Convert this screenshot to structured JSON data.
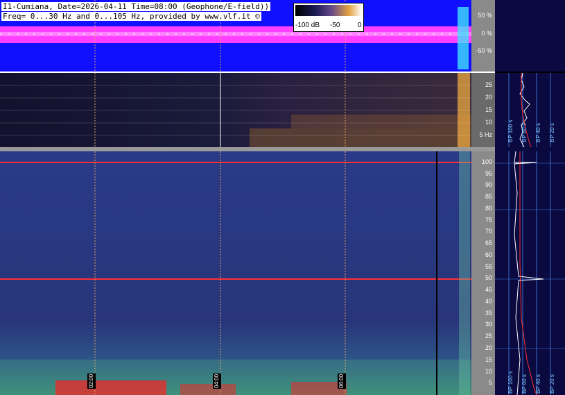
{
  "header": {
    "line1": "I1-Cumiana, Date=2026-04-11 Time=08:00 (Geophone/E-field))",
    "line2": "Freq= 0...30 Hz and 0...105 Hz, provided by www.vlf.it ©"
  },
  "legend": {
    "min_label": "-100 dB",
    "mid_label": "-50",
    "max_label": "0"
  },
  "waveform_axis": {
    "ticks": [
      "50 %",
      "0 %",
      "-50 %"
    ]
  },
  "spectro30_axis": {
    "ticks": [
      "25",
      "20",
      "15",
      "10",
      "5 Hz"
    ]
  },
  "spectro105_axis": {
    "ticks": [
      "100",
      "95",
      "90",
      "85",
      "80",
      "75",
      "70",
      "65",
      "60",
      "55",
      "50",
      "45",
      "40",
      "35",
      "30",
      "25",
      "20",
      "15",
      "10",
      "5"
    ]
  },
  "time_labels": [
    "02:00",
    "04:00",
    "06:00"
  ],
  "side_upper": {
    "labels": [
      "BP 100 s",
      "BP 60 s",
      "BP 40 s",
      "BP 20 s"
    ]
  },
  "side_lower": {
    "labels": [
      "BP 100 s",
      "BP 60 s",
      "BP 40 s",
      "BP 20 s"
    ]
  },
  "colors": {
    "waveform_bg": "#1010ff",
    "waveform_signal": "#ff40ff",
    "spectro_bg": "#1a1a3a",
    "spectro105_bg": "#25307a",
    "mains_line": "#ff3030",
    "axis_bg": "#8a8a8a",
    "grid": "#e0a060"
  }
}
